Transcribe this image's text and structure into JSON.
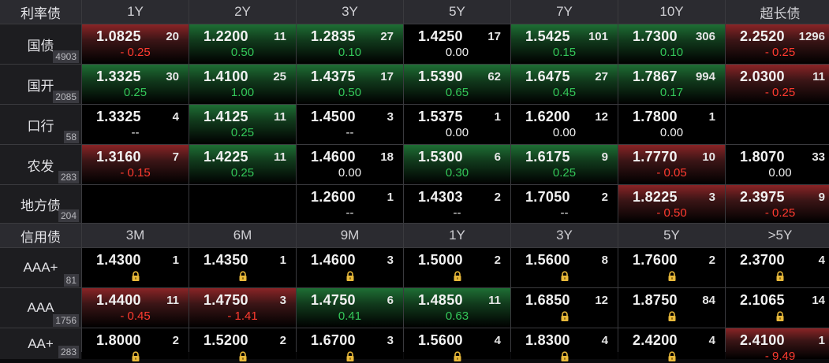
{
  "rate_section": {
    "title": "利率债",
    "tenors": [
      "1Y",
      "2Y",
      "3Y",
      "5Y",
      "7Y",
      "10Y",
      "超长债"
    ],
    "rows": [
      {
        "name": "国债",
        "count": "4903",
        "cells": [
          {
            "price": "1.0825",
            "vol": "20",
            "chg": "- 0.25",
            "dir": "neg",
            "bg": "up"
          },
          {
            "price": "1.2200",
            "vol": "11",
            "chg": "0.50",
            "dir": "pos",
            "bg": "down"
          },
          {
            "price": "1.2835",
            "vol": "27",
            "chg": "0.10",
            "dir": "pos",
            "bg": "down"
          },
          {
            "price": "1.4250",
            "vol": "17",
            "chg": "0.00",
            "dir": "flat",
            "bg": ""
          },
          {
            "price": "1.5425",
            "vol": "101",
            "chg": "0.15",
            "dir": "pos",
            "bg": "down"
          },
          {
            "price": "1.7300",
            "vol": "306",
            "chg": "0.10",
            "dir": "pos",
            "bg": "down"
          },
          {
            "price": "2.2520",
            "vol": "1296",
            "chg": "- 0.25",
            "dir": "neg",
            "bg": "up"
          }
        ]
      },
      {
        "name": "国开",
        "count": "2085",
        "cells": [
          {
            "price": "1.3325",
            "vol": "30",
            "chg": "0.25",
            "dir": "pos",
            "bg": "down"
          },
          {
            "price": "1.4100",
            "vol": "25",
            "chg": "1.00",
            "dir": "pos",
            "bg": "down"
          },
          {
            "price": "1.4375",
            "vol": "17",
            "chg": "0.50",
            "dir": "pos",
            "bg": "down"
          },
          {
            "price": "1.5390",
            "vol": "62",
            "chg": "0.65",
            "dir": "pos",
            "bg": "down"
          },
          {
            "price": "1.6475",
            "vol": "27",
            "chg": "0.45",
            "dir": "pos",
            "bg": "down"
          },
          {
            "price": "1.7867",
            "vol": "994",
            "chg": "0.17",
            "dir": "pos",
            "bg": "down"
          },
          {
            "price": "2.0300",
            "vol": "11",
            "chg": "- 0.25",
            "dir": "neg",
            "bg": "up"
          }
        ]
      },
      {
        "name": "口行",
        "count": "58",
        "cells": [
          {
            "price": "1.3325",
            "vol": "4",
            "chg": "--",
            "dir": "flat",
            "bg": ""
          },
          {
            "price": "1.4125",
            "vol": "11",
            "chg": "0.25",
            "dir": "pos",
            "bg": "down"
          },
          {
            "price": "1.4500",
            "vol": "3",
            "chg": "--",
            "dir": "flat",
            "bg": ""
          },
          {
            "price": "1.5375",
            "vol": "1",
            "chg": "0.00",
            "dir": "flat",
            "bg": ""
          },
          {
            "price": "1.6200",
            "vol": "12",
            "chg": "0.00",
            "dir": "flat",
            "bg": ""
          },
          {
            "price": "1.7800",
            "vol": "1",
            "chg": "0.00",
            "dir": "flat",
            "bg": ""
          },
          {
            "price": "",
            "vol": "",
            "chg": "",
            "dir": "flat",
            "bg": ""
          }
        ]
      },
      {
        "name": "农发",
        "count": "283",
        "cells": [
          {
            "price": "1.3160",
            "vol": "7",
            "chg": "- 0.15",
            "dir": "neg",
            "bg": "up"
          },
          {
            "price": "1.4225",
            "vol": "11",
            "chg": "0.25",
            "dir": "pos",
            "bg": "down"
          },
          {
            "price": "1.4600",
            "vol": "18",
            "chg": "0.00",
            "dir": "flat",
            "bg": ""
          },
          {
            "price": "1.5300",
            "vol": "6",
            "chg": "0.30",
            "dir": "pos",
            "bg": "down"
          },
          {
            "price": "1.6175",
            "vol": "9",
            "chg": "0.25",
            "dir": "pos",
            "bg": "down"
          },
          {
            "price": "1.7770",
            "vol": "10",
            "chg": "- 0.05",
            "dir": "neg",
            "bg": "up"
          },
          {
            "price": "1.8070",
            "vol": "33",
            "chg": "0.00",
            "dir": "flat",
            "bg": ""
          }
        ]
      },
      {
        "name": "地方债",
        "count": "204",
        "cells": [
          {
            "price": "",
            "vol": "",
            "chg": "",
            "dir": "flat",
            "bg": ""
          },
          {
            "price": "",
            "vol": "",
            "chg": "",
            "dir": "flat",
            "bg": ""
          },
          {
            "price": "1.2600",
            "vol": "1",
            "chg": "--",
            "dir": "flat",
            "bg": ""
          },
          {
            "price": "1.4303",
            "vol": "2",
            "chg": "--",
            "dir": "flat",
            "bg": ""
          },
          {
            "price": "1.7050",
            "vol": "2",
            "chg": "--",
            "dir": "flat",
            "bg": ""
          },
          {
            "price": "1.8225",
            "vol": "3",
            "chg": "- 0.50",
            "dir": "neg",
            "bg": "up"
          },
          {
            "price": "2.3975",
            "vol": "9",
            "chg": "- 0.25",
            "dir": "neg",
            "bg": "up"
          }
        ]
      }
    ]
  },
  "credit_section": {
    "title": "信用债",
    "tenors": [
      "3M",
      "6M",
      "9M",
      "1Y",
      "3Y",
      "5Y",
      ">5Y"
    ],
    "rows": [
      {
        "name": "AAA+",
        "count": "81",
        "cells": [
          {
            "price": "1.4300",
            "vol": "1",
            "chg": "lock",
            "dir": "flat",
            "bg": ""
          },
          {
            "price": "1.4350",
            "vol": "1",
            "chg": "lock",
            "dir": "flat",
            "bg": ""
          },
          {
            "price": "1.4600",
            "vol": "3",
            "chg": "lock",
            "dir": "flat",
            "bg": ""
          },
          {
            "price": "1.5000",
            "vol": "2",
            "chg": "lock",
            "dir": "flat",
            "bg": ""
          },
          {
            "price": "1.5600",
            "vol": "8",
            "chg": "lock",
            "dir": "flat",
            "bg": ""
          },
          {
            "price": "1.7600",
            "vol": "2",
            "chg": "lock",
            "dir": "flat",
            "bg": ""
          },
          {
            "price": "2.3700",
            "vol": "4",
            "chg": "lock",
            "dir": "flat",
            "bg": ""
          }
        ]
      },
      {
        "name": "AAA",
        "count": "1756",
        "cells": [
          {
            "price": "1.4400",
            "vol": "11",
            "chg": "- 0.45",
            "dir": "neg",
            "bg": "up"
          },
          {
            "price": "1.4750",
            "vol": "3",
            "chg": "- 1.41",
            "dir": "neg",
            "bg": "up"
          },
          {
            "price": "1.4750",
            "vol": "6",
            "chg": "0.41",
            "dir": "pos",
            "bg": "down"
          },
          {
            "price": "1.4850",
            "vol": "11",
            "chg": "0.63",
            "dir": "pos",
            "bg": "down"
          },
          {
            "price": "1.6850",
            "vol": "12",
            "chg": "lock",
            "dir": "flat",
            "bg": ""
          },
          {
            "price": "1.8750",
            "vol": "84",
            "chg": "lock",
            "dir": "flat",
            "bg": ""
          },
          {
            "price": "2.1065",
            "vol": "14",
            "chg": "lock",
            "dir": "flat",
            "bg": ""
          }
        ]
      },
      {
        "name": "AA+",
        "count": "283",
        "cells": [
          {
            "price": "1.8000",
            "vol": "2",
            "chg": "lock",
            "dir": "flat",
            "bg": ""
          },
          {
            "price": "1.5200",
            "vol": "2",
            "chg": "lock",
            "dir": "flat",
            "bg": ""
          },
          {
            "price": "1.6700",
            "vol": "3",
            "chg": "lock",
            "dir": "flat",
            "bg": ""
          },
          {
            "price": "1.5600",
            "vol": "4",
            "chg": "lock",
            "dir": "flat",
            "bg": ""
          },
          {
            "price": "1.8300",
            "vol": "4",
            "chg": "lock",
            "dir": "flat",
            "bg": ""
          },
          {
            "price": "2.4200",
            "vol": "4",
            "chg": "lock",
            "dir": "flat",
            "bg": ""
          },
          {
            "price": "2.4100",
            "vol": "1",
            "chg": "- 9.49",
            "dir": "neg",
            "bg": "up"
          }
        ]
      }
    ]
  },
  "colors": {
    "pos": "#34c759",
    "neg": "#ff3b30",
    "up_bg": "#8a2426",
    "down_bg": "#1e6e34"
  }
}
